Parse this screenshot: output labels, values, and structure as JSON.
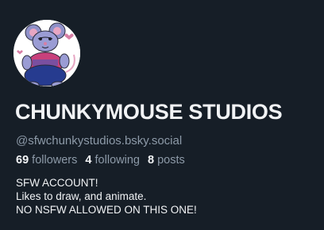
{
  "profile": {
    "display_name": "CHUNKYMOUSE STUDIOS",
    "handle": "@sfwchunkystudios.bsky.social",
    "avatar_icon": "chunky-mouse-avatar"
  },
  "stats": {
    "followers_count": "69",
    "followers_label": "followers",
    "following_count": "4",
    "following_label": "following",
    "posts_count": "8",
    "posts_label": "posts"
  },
  "bio": {
    "line1": "SFW ACCOUNT!",
    "line2": "Likes to draw, and animate.",
    "line3": "NO NSFW ALLOWED ON THIS ONE!"
  },
  "colors": {
    "background": "#161e27",
    "text_primary": "#f1f3f5",
    "text_secondary": "#8d9aa8"
  }
}
